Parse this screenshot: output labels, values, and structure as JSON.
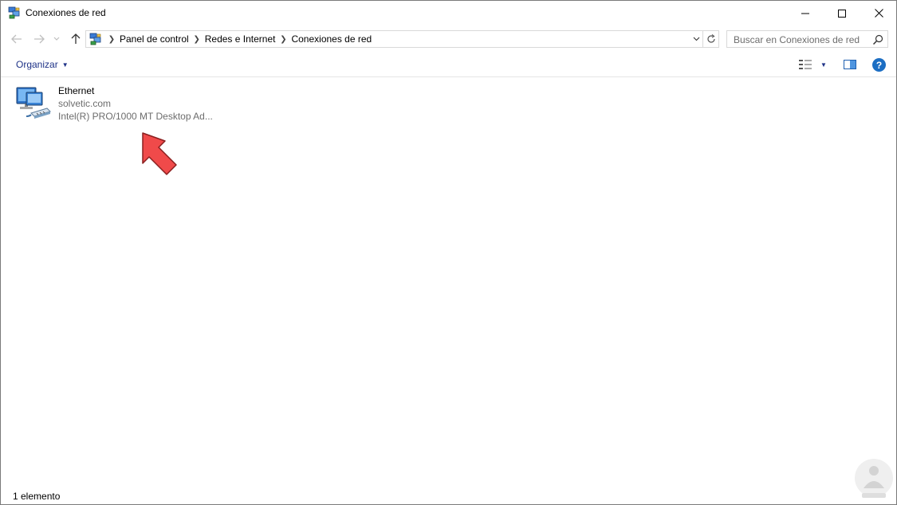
{
  "window": {
    "title": "Conexiones de red",
    "controls": {
      "minimize": "minimize-icon",
      "maximize": "maximize-icon",
      "close": "close-icon"
    }
  },
  "navigation": {
    "back_icon": "arrow-left-icon",
    "forward_icon": "arrow-right-icon",
    "recent_icon": "chevron-down-icon",
    "up_icon": "arrow-up-icon",
    "breadcrumbs": [
      "Panel de control",
      "Redes e Internet",
      "Conexiones de red"
    ],
    "refresh_icon": "refresh-icon"
  },
  "search": {
    "placeholder": "Buscar en Conexiones de red",
    "icon": "search-icon"
  },
  "commandbar": {
    "organize_label": "Organizar",
    "view_icon": "view-options-icon",
    "pane_icon": "preview-pane-icon",
    "help_label": "?"
  },
  "connections": [
    {
      "name": "Ethernet",
      "network": "solvetic.com",
      "device": "Intel(R) PRO/1000 MT Desktop Ad...",
      "icon": "network-adapter-icon"
    }
  ],
  "statusbar": {
    "item_count": "1 elemento"
  },
  "colors": {
    "link_blue": "#1e3287",
    "help_blue": "#1c6ec3",
    "secondary_text": "#6d6d6d",
    "annotation_red": "#f04a4a"
  }
}
